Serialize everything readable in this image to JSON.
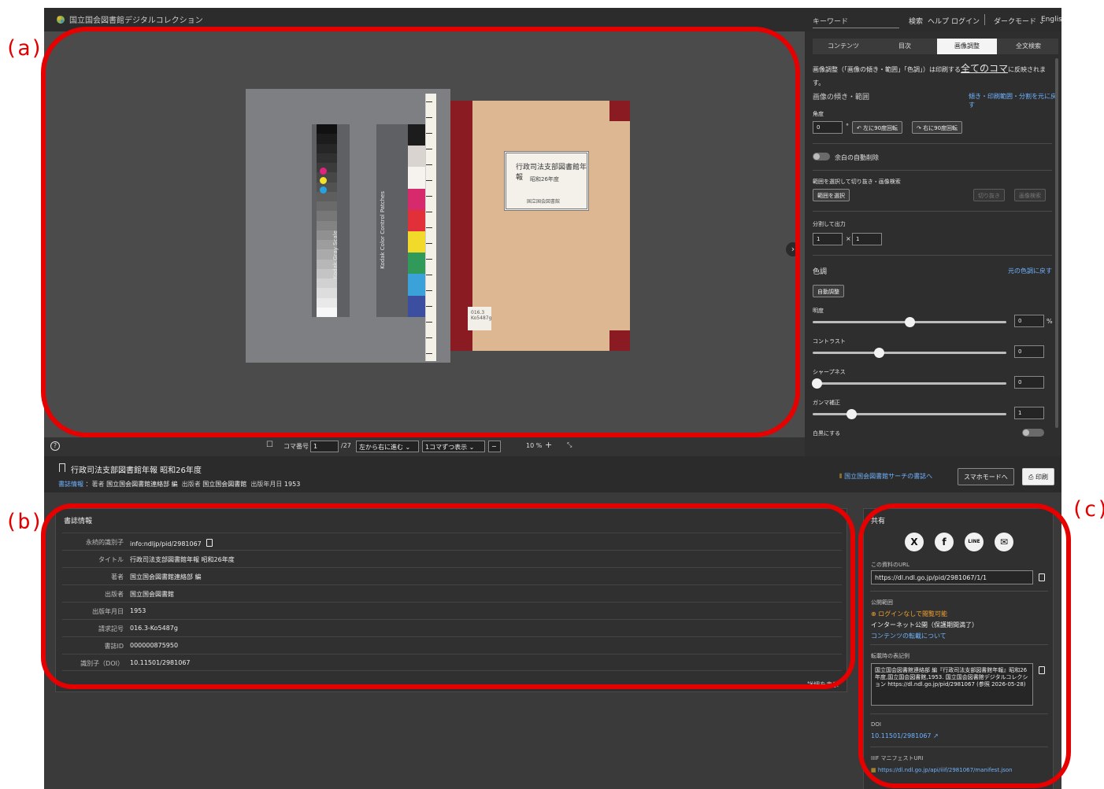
{
  "annotations": {
    "a": "(a)",
    "b": "(b)",
    "c": "(c)"
  },
  "header": {
    "brand": "国立国会図書館デジタルコレクション",
    "keyword_placeholder": "キーワード",
    "search": "検索",
    "help": "ヘルプ",
    "login": "ログイン",
    "darkmode": "ダークモード",
    "english": "English"
  },
  "viewer": {
    "kodak_gray": "Kodak Gray Scale",
    "kodak_color": "Kodak Color Control Patches",
    "book_title": "行政司法支部図書館年報",
    "book_year": "昭和26年度",
    "book_publisher": "国立国会図書館",
    "stamp_text": "016.3 Ko5487g",
    "next_glyph": "›"
  },
  "viewer_toolbar": {
    "help_glyph": "?",
    "frame_label": "コマ番号",
    "frame_value": "1",
    "frame_total": "/27",
    "direction": "左から右に進む",
    "display_mode": "1コマずつ表示",
    "zoom": "10 %",
    "minus": "−",
    "plus": "+"
  },
  "info": {
    "title": "行政司法支部図書館年報 昭和26年度",
    "meta_label": "書誌情報",
    "author_label": "：著者",
    "author": "国立国会図書館連絡部 編",
    "publisher_label": "出版者",
    "publisher": "国立国会図書館",
    "date_label": "出版年月日",
    "date": "1953",
    "search_link": "国立国会図書館サーチの書誌へ",
    "smartphone": "スマホモードへ",
    "print": "印刷"
  },
  "right_panel": {
    "tabs": [
      "コンテンツ",
      "目次",
      "画像調整",
      "全文検索"
    ],
    "intro_1": "画像調整（「画像の傾き・範囲」「色調」）は印刷する",
    "intro_emph": "全てのコマ",
    "intro_2": "に反映されま",
    "intro_3": "す。",
    "tilt_heading": "画像の傾き・範囲",
    "tilt_reset": "傾き・印刷範囲・分割を元に戻す",
    "angle_label": "角度",
    "angle_value": "0",
    "angle_unit": "°",
    "rotate_left": "左に90度回転",
    "rotate_right": "右に90度回転",
    "autocrop": "余白の自動削除",
    "crop_heading": "範囲を選択して切り抜き・画像検索",
    "select_range": "範囲を選択",
    "crop": "切り抜き",
    "image_search": "画像検索",
    "split_heading": "分割して出力",
    "split_x": "1",
    "split_times": "×",
    "split_y": "1",
    "color_heading": "色調",
    "color_reset": "元の色調に戻す",
    "auto_adjust": "自動調整",
    "brightness": {
      "label": "明度",
      "value": "0",
      "unit": "%",
      "level": 0.5
    },
    "contrast": {
      "label": "コントラスト",
      "value": "0",
      "level": 0.34
    },
    "sharpness": {
      "label": "シャープネス",
      "value": "0",
      "level": 0.02
    },
    "gamma": {
      "label": "ガンマ補正",
      "value": "1",
      "level": 0.2
    },
    "bw": "白黒にする"
  },
  "bibliographic": {
    "heading": "書誌情報",
    "rows": [
      {
        "k": "永続的識別子",
        "v": "info:ndljp/pid/2981067"
      },
      {
        "k": "タイトル",
        "v": "行政司法支部図書館年報 昭和26年度"
      },
      {
        "k": "著者",
        "v": "国立国会図書館連絡部 編"
      },
      {
        "k": "出版者",
        "v": "国立国会図書館"
      },
      {
        "k": "出版年月日",
        "v": "1953"
      },
      {
        "k": "請求記号",
        "v": "016.3-Ko5487g"
      },
      {
        "k": "書誌ID",
        "v": "000000875950"
      },
      {
        "k": "識別子（DOI）",
        "v": "10.11501/2981067"
      }
    ],
    "more": "詳細を表示"
  },
  "share": {
    "heading": "共有",
    "icons": [
      "X",
      "f",
      "LINE",
      "✉"
    ],
    "url_label": "この資料のURL",
    "url": "https://dl.ndl.go.jp/pid/2981067/1/1",
    "scope_label": "公開範囲",
    "scope_1": "ログインなしで閲覧可能",
    "scope_2": "インターネット公開（保護期間満了）",
    "scope_link": "コンテンツの転載について",
    "cite_label": "転載時の表記例",
    "cite": "国立国会図書館連絡部 編『行政司法支部図書館年報』昭和26年度,国立国会図書館,1953. 国立国会図書館デジタルコレクション https://dl.ndl.go.jp/pid/2981067 (参照 2026-05-28)",
    "doi_label": "DOI",
    "doi": "10.11501/2981067",
    "iiif_label": "IIIF マニフェストURI",
    "iiif": "https://dl.ndl.go.jp/api/iiif/2981067/manifest.json"
  }
}
